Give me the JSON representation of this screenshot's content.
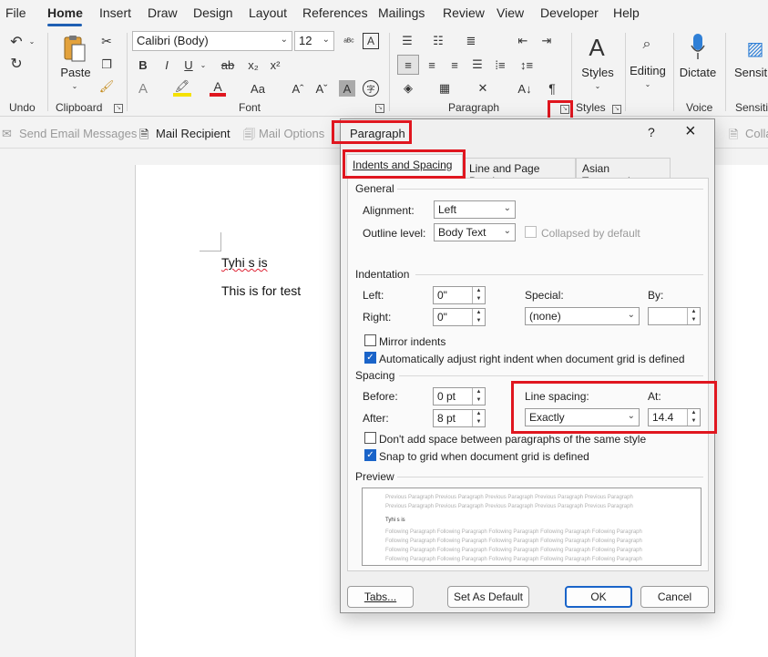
{
  "ribbon_tabs": [
    "File",
    "Home",
    "Insert",
    "Draw",
    "Design",
    "Layout",
    "References",
    "Mailings",
    "Review",
    "View",
    "Developer",
    "Help"
  ],
  "ribbon": {
    "groups": {
      "undo": "Undo",
      "clipboard": "Clipboard",
      "font": "Font",
      "paragraph": "Paragraph",
      "styles": "Styles",
      "voice": "Voice",
      "sensitivity": "Sensitiv"
    },
    "paste": "Paste",
    "font_name": "Calibri (Body)",
    "font_size": "12",
    "styles_label": "Styles",
    "editing_label": "Editing",
    "dictate_label": "Dictate",
    "sensitivity_label": "Sensitiv"
  },
  "mailbar": {
    "send_email": "Send Email Messages",
    "mail_recipient": "Mail Recipient",
    "mail_options": "Mail Options",
    "colla": "Colla"
  },
  "document": {
    "line1": "Tyhi s is",
    "line2": "This is for test"
  },
  "dialog": {
    "title": "Paragraph",
    "help": "?",
    "tabs": [
      "Indents and Spacing",
      "Line and Page Breaks",
      "Asian Typography"
    ],
    "general": {
      "section": "General",
      "alignment_label": "Alignment:",
      "alignment_value": "Left",
      "outline_label": "Outline level:",
      "outline_value": "Body Text",
      "collapsed_label": "Collapsed by default"
    },
    "indentation": {
      "section": "Indentation",
      "left_label": "Left:",
      "left_value": "0\"",
      "right_label": "Right:",
      "right_value": "0\"",
      "special_label": "Special:",
      "special_value": "(none)",
      "by_label": "By:",
      "by_value": "",
      "mirror_label": "Mirror indents",
      "auto_adjust_label": "Automatically adjust right indent when document grid is defined"
    },
    "spacing": {
      "section": "Spacing",
      "before_label": "Before:",
      "before_value": "0 pt",
      "after_label": "After:",
      "after_value": "8 pt",
      "line_spacing_label": "Line spacing:",
      "line_spacing_value": "Exactly",
      "at_label": "At:",
      "at_value": "14.4",
      "dont_add_label": "Don't add space between paragraphs of the same style",
      "snap_label": "Snap to grid when document grid is defined"
    },
    "preview": {
      "section": "Preview",
      "prev_text": "Previous Paragraph Previous Paragraph Previous Paragraph Previous Paragraph Previous Paragraph",
      "current_text": "Tyhi s is",
      "follow_text": "Following Paragraph Following Paragraph Following Paragraph Following Paragraph Following Paragraph"
    },
    "buttons": {
      "tabs": "Tabs...",
      "default": "Set As Default",
      "ok": "OK",
      "cancel": "Cancel"
    }
  },
  "colors": {
    "accent": "#1a64c9",
    "highlight_box": "#e0161f"
  }
}
